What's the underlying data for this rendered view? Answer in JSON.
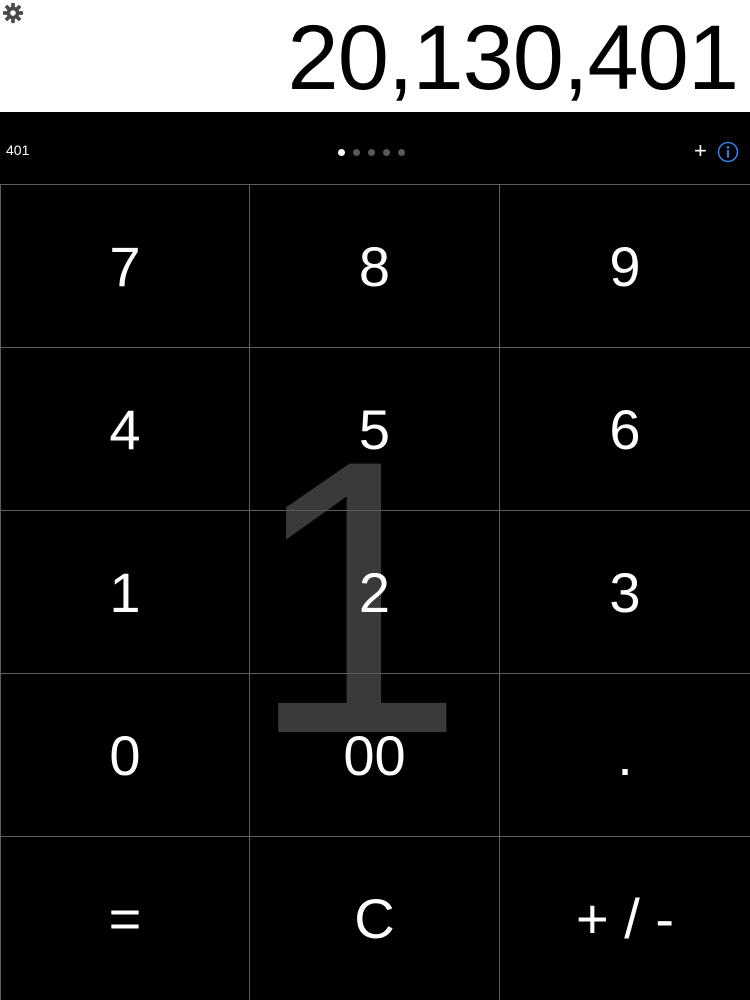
{
  "display": {
    "value": "20,130,401"
  },
  "infobar": {
    "history_value": "401",
    "add_label": "+",
    "page_count": 5,
    "active_page": 1
  },
  "watermark": {
    "digit": "1"
  },
  "keypad": {
    "keys": [
      "7",
      "8",
      "9",
      "4",
      "5",
      "6",
      "1",
      "2",
      "3",
      "0",
      "00",
      ".",
      "=",
      "C",
      "+ / -"
    ]
  },
  "colors": {
    "display_background": "#ffffff",
    "keypad_background": "#000000",
    "key_text": "#ffffff",
    "grid_lines": "#5c5c5c",
    "info_icon": "#2f7de1",
    "watermark": "#3a3a3a"
  },
  "icons": {
    "settings": "gear-icon",
    "info": "info-icon"
  }
}
